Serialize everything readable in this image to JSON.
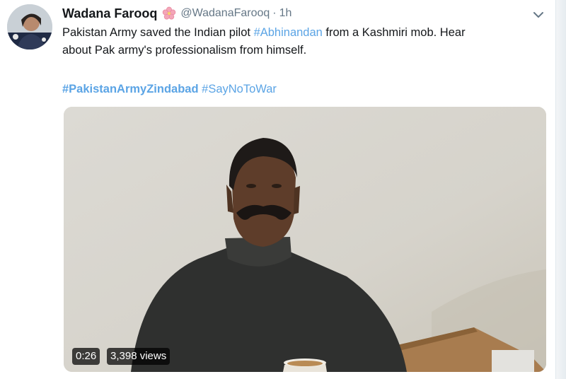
{
  "tweet": {
    "display_name": "Wadana Farooq",
    "handle": "@WadanaFarooq",
    "separator": "·",
    "time": "1h",
    "text_before": "Pakistan Army saved the Indian pilot ",
    "text_hashtag": "#Abhinandan",
    "text_after_line1": " from a Kashmiri mob. Hear",
    "text_line2": "about Pak army's professionalism from himself.",
    "hashtag_1": "#PakistanArmyZindabad",
    "hashtag_2": "#SayNoToWar"
  },
  "video": {
    "duration": "0:26",
    "views": "3,398 views"
  },
  "icons": {
    "verified_flower": "cherry-blossom-icon",
    "menu": "chevron-down-icon"
  },
  "colors": {
    "hashtag": "#5ba4e5",
    "name": "#14171a",
    "muted": "#657786"
  }
}
